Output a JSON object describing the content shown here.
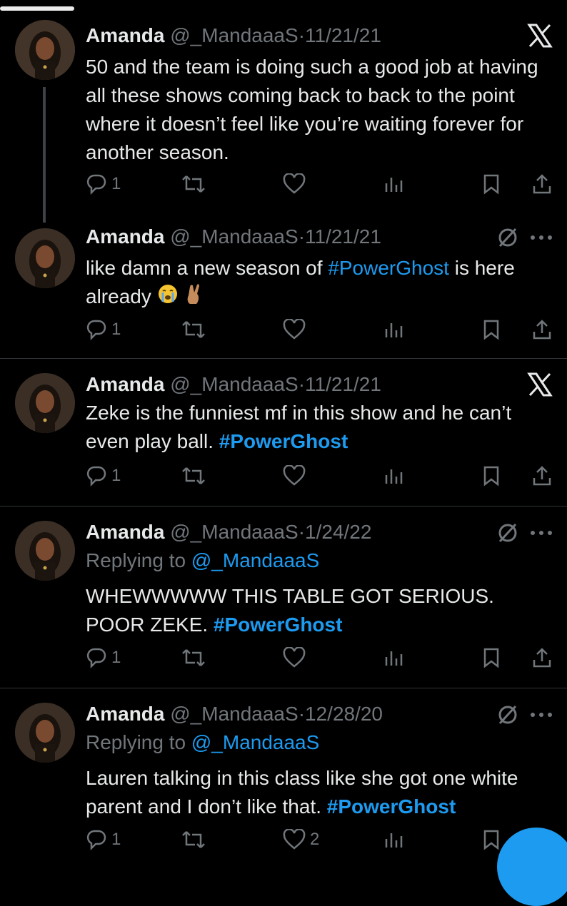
{
  "colors": {
    "background": "#000000",
    "text": "#e7e9ea",
    "muted": "#71767b",
    "link": "#1d9bf0",
    "divider": "#2f3336"
  },
  "tweets": [
    {
      "name": "Amanda",
      "handle": "@_MandaaaS",
      "sep": "·",
      "date": "11/21/21",
      "badge_icon": "x-logo-icon",
      "text": "50 and the team is doing such a good job at having all these shows coming back to back to the point where it doesn’t feel like you’re waiting forever for another season.",
      "reply_count": "1",
      "like_count": ""
    },
    {
      "name": "Amanda",
      "handle": "@_MandaaaS",
      "sep": "·",
      "date": "11/21/21",
      "badge_icon": "grok-icon",
      "text_before": "like damn a new season of ",
      "hashtag": "#PowerGhost",
      "text_after": " is here already",
      "emojis": [
        "loudly-crying-face-emoji",
        "crossed-fingers-emoji"
      ],
      "reply_count": "1",
      "like_count": ""
    },
    {
      "name": "Amanda",
      "handle": "@_MandaaaS",
      "sep": "·",
      "date": "11/21/21",
      "badge_icon": "x-logo-icon",
      "text_before": "Zeke is the funniest mf in this show and he can’t even play ball. ",
      "hashtag": "#PowerGhost",
      "reply_count": "1",
      "like_count": ""
    },
    {
      "name": "Amanda",
      "handle": "@_MandaaaS",
      "sep": "·",
      "date": "1/24/22",
      "badge_icon": "grok-icon",
      "replying_label": "Replying to ",
      "replying_handle": "@_MandaaaS",
      "text_before": "WHEWWWWW THIS TABLE GOT SERIOUS. POOR ZEKE. ",
      "hashtag": "#PowerGhost",
      "reply_count": "1",
      "like_count": ""
    },
    {
      "name": "Amanda",
      "handle": "@_MandaaaS",
      "sep": "·",
      "date": "12/28/20",
      "badge_icon": "grok-icon",
      "replying_label": "Replying to ",
      "replying_handle": "@_MandaaaS",
      "text_before": "Lauren talking in this class like she got one white parent and I don’t like that. ",
      "hashtag": "#PowerGhost",
      "reply_count": "1",
      "like_count": "2"
    }
  ]
}
